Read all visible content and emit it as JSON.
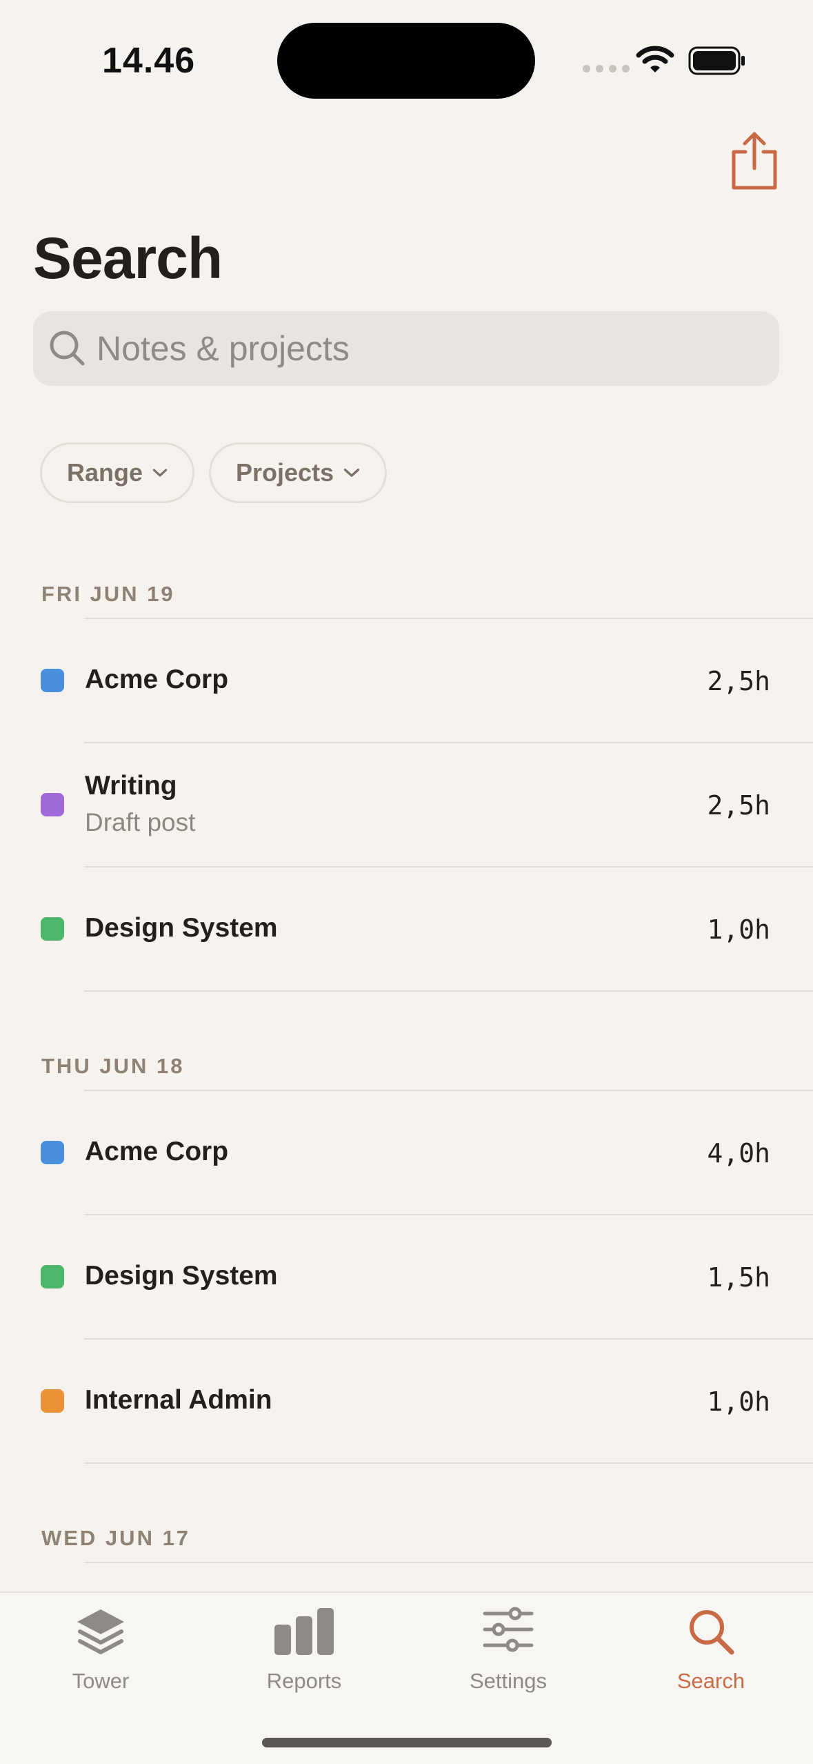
{
  "status_bar": {
    "time": "14.46"
  },
  "page": {
    "title": "Search"
  },
  "search": {
    "placeholder": "Notes & projects"
  },
  "filters": [
    {
      "label": "Range"
    },
    {
      "label": "Projects"
    }
  ],
  "days": [
    {
      "header": "FRI JUN 19",
      "entries": [
        {
          "project": "Acme Corp",
          "note": "",
          "duration": "2,5h",
          "color": "#4a8fdc"
        },
        {
          "project": "Writing",
          "note": "Draft post",
          "duration": "2,5h",
          "color": "#a26ad8"
        },
        {
          "project": "Design System",
          "note": "",
          "duration": "1,0h",
          "color": "#4cb66a"
        }
      ]
    },
    {
      "header": "THU JUN 18",
      "entries": [
        {
          "project": "Acme Corp",
          "note": "",
          "duration": "4,0h",
          "color": "#4a8fdc"
        },
        {
          "project": "Design System",
          "note": "",
          "duration": "1,5h",
          "color": "#4cb66a"
        },
        {
          "project": "Internal Admin",
          "note": "",
          "duration": "1,0h",
          "color": "#ea9236"
        }
      ]
    },
    {
      "header": "WED JUN 17",
      "entries": []
    }
  ],
  "tab_bar": {
    "tabs": [
      {
        "label": "Tower",
        "icon": "layers-icon",
        "active": false
      },
      {
        "label": "Reports",
        "icon": "bar-chart-icon",
        "active": false
      },
      {
        "label": "Settings",
        "icon": "sliders-icon",
        "active": false
      },
      {
        "label": "Search",
        "icon": "search-icon",
        "active": true
      }
    ]
  },
  "colors": {
    "accent": "#c96a47",
    "background": "#f6f3ee"
  }
}
